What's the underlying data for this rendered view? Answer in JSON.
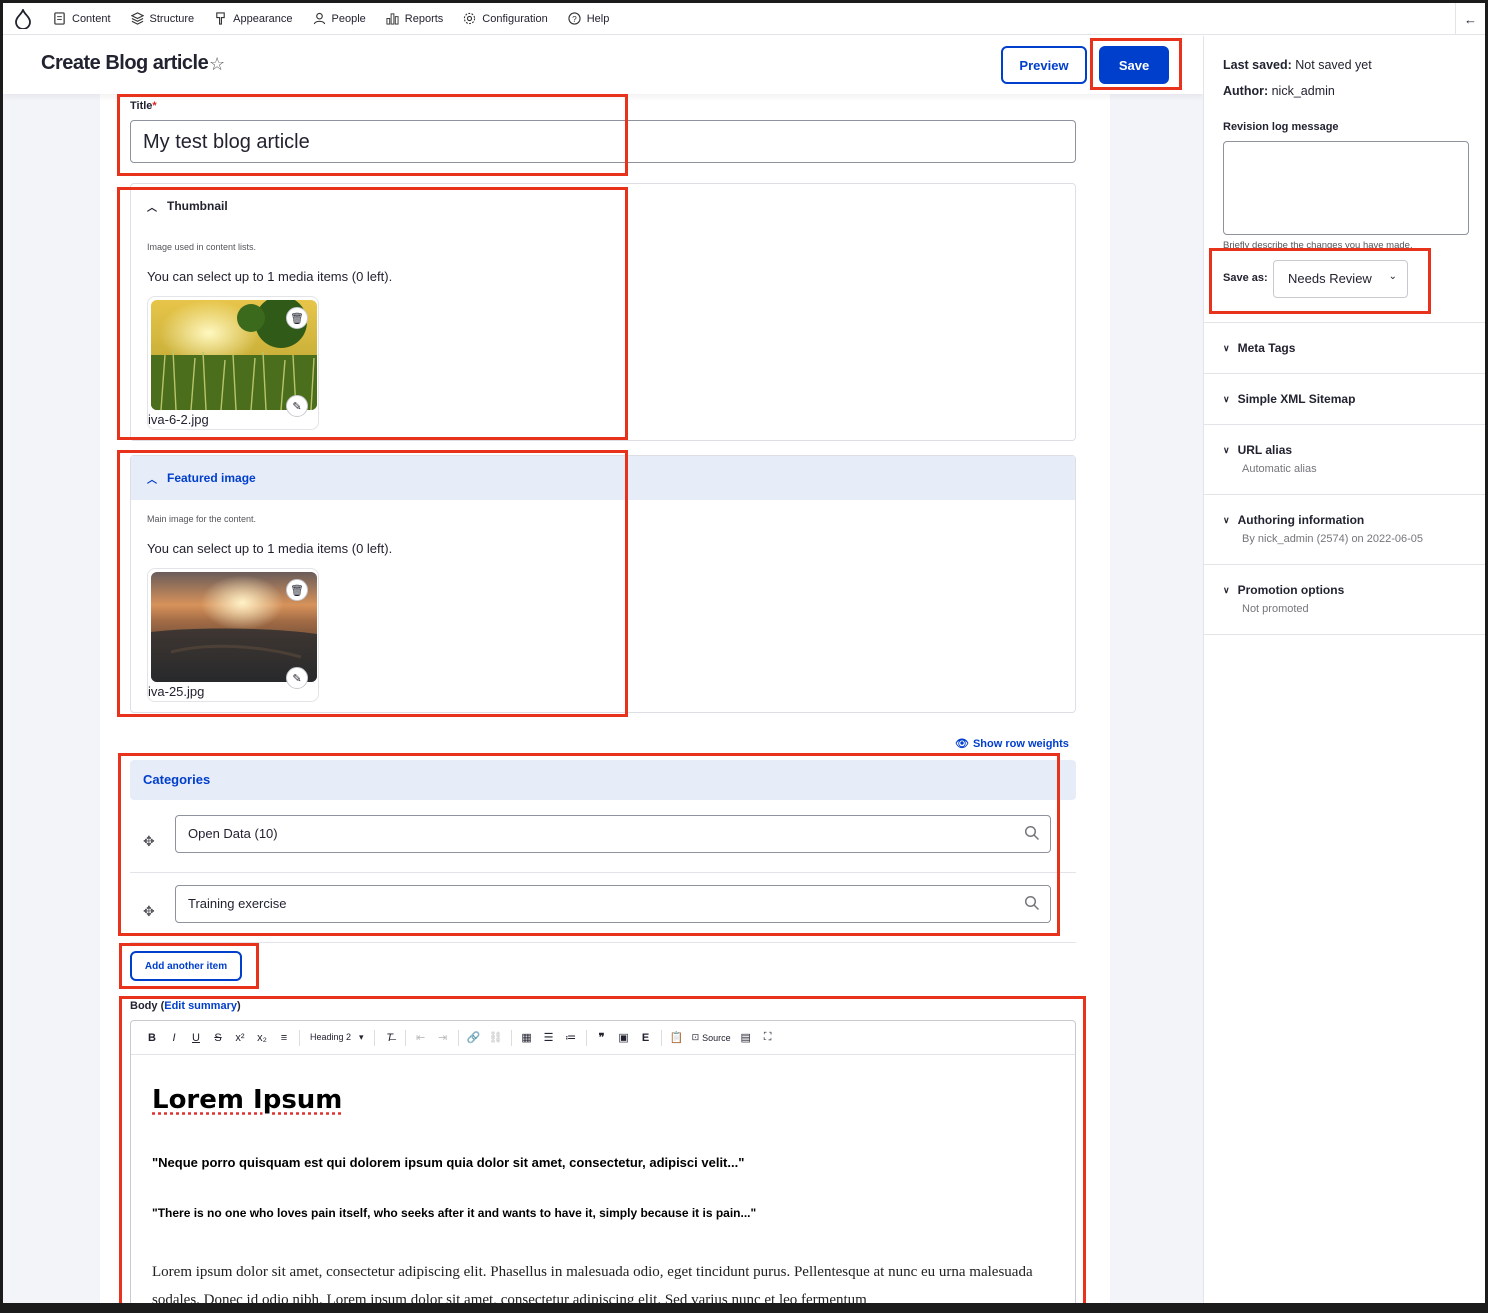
{
  "toolbar": {
    "items": [
      {
        "label": "Content",
        "icon": "document-icon"
      },
      {
        "label": "Structure",
        "icon": "layers-icon"
      },
      {
        "label": "Appearance",
        "icon": "brush-icon"
      },
      {
        "label": "People",
        "icon": "person-icon"
      },
      {
        "label": "Reports",
        "icon": "bar-chart-icon"
      },
      {
        "label": "Configuration",
        "icon": "gear-icon"
      },
      {
        "label": "Help",
        "icon": "help-circle-icon"
      }
    ]
  },
  "header": {
    "title": "Create Blog article",
    "preview_label": "Preview",
    "save_label": "Save"
  },
  "form": {
    "title_label": "Title",
    "title_required_mark": "*",
    "title_value": "My test blog article",
    "thumbnail": {
      "legend": "Thumbnail",
      "description": "Image used in content lists.",
      "limit_text": "You can select up to 1 media items (0 left).",
      "file_name": "iva-6-2.jpg"
    },
    "featured": {
      "legend": "Featured image",
      "description": "Main image for the content.",
      "limit_text": "You can select up to 1 media items (0 left).",
      "file_name": "iva-25.jpg"
    },
    "show_row_weights": "Show row weights",
    "categories": {
      "heading": "Categories",
      "items": [
        "Open Data (10)",
        "Training exercise"
      ],
      "add_another": "Add another item"
    },
    "body": {
      "label": "Body",
      "open_paren": "(",
      "edit_summary": "Edit summary",
      "close_paren": ")",
      "heading_select": "Heading 2",
      "source_label": "Source",
      "h1": "Lorem Ipsum",
      "quote1": "\"Neque porro quisquam est qui dolorem ipsum quia dolor sit amet, consectetur, adipisci velit...\"",
      "quote2": "\"There is no one who loves pain itself, who seeks after it and wants to have it, simply because it is pain...\"",
      "paragraph": "Lorem ipsum dolor sit amet, consectetur adipiscing elit. Phasellus in malesuada odio, eget tincidunt purus. Pellentesque at nunc eu urna malesuada sodales. Donec id odio nibh. Lorem ipsum dolor sit amet, consectetur adipiscing elit. Sed varius nunc et leo fermentum"
    }
  },
  "sidebar": {
    "last_saved_label": "Last saved:",
    "last_saved_value": "Not saved yet",
    "author_label": "Author:",
    "author_value": "nick_admin",
    "revision_label": "Revision log message",
    "revision_help": "Briefly describe the changes you have made.",
    "save_as_label": "Save as:",
    "save_as_value": "Needs Review",
    "accordions": [
      {
        "title": "Meta Tags",
        "sub": ""
      },
      {
        "title": "Simple XML Sitemap",
        "sub": ""
      },
      {
        "title": "URL alias",
        "sub": "Automatic alias"
      },
      {
        "title": "Authoring information",
        "sub": "By nick_admin (2574) on 2022-06-05"
      },
      {
        "title": "Promotion options",
        "sub": "Not promoted"
      }
    ]
  },
  "colors": {
    "accent": "#003ecc",
    "annotation": "#e8321b",
    "active_fieldset_bg": "#e6ecf8"
  }
}
